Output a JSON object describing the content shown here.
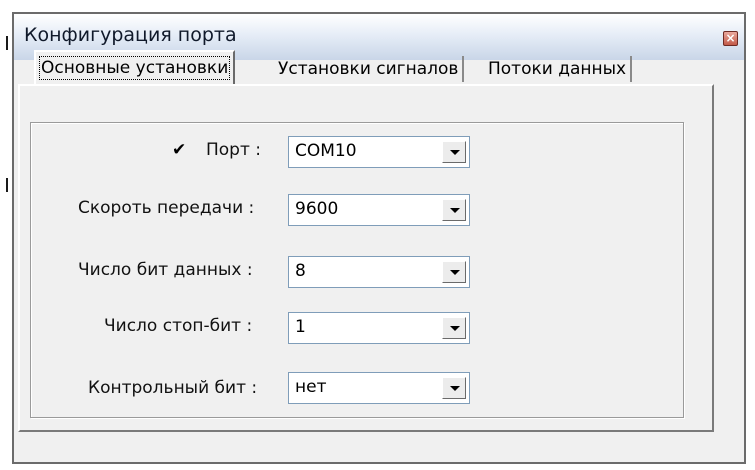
{
  "window": {
    "title": "Конфигурация порта",
    "close_icon": "close-icon"
  },
  "tabs": [
    {
      "label": "Основные установки",
      "active": true
    },
    {
      "label": "Установки сигналов",
      "active": false
    },
    {
      "label": "Потоки данных",
      "active": false
    }
  ],
  "form": {
    "port": {
      "label": "Порт :",
      "value": "COM10",
      "checked": true,
      "check_icon": "checkmark-icon"
    },
    "baud": {
      "label": "Скороть передачи :",
      "value": "9600"
    },
    "data_bits": {
      "label": "Число бит данных :",
      "value": "8"
    },
    "stop_bits": {
      "label": "Число стоп-бит :",
      "value": "1"
    },
    "parity": {
      "label": "Контрольный бит :",
      "value": "нет"
    }
  },
  "colors": {
    "titlebar_top": "#ffffff",
    "titlebar_bottom": "#c9d6e8",
    "dialog_bg": "#f0f0f0",
    "close_button": "#c25a49"
  }
}
